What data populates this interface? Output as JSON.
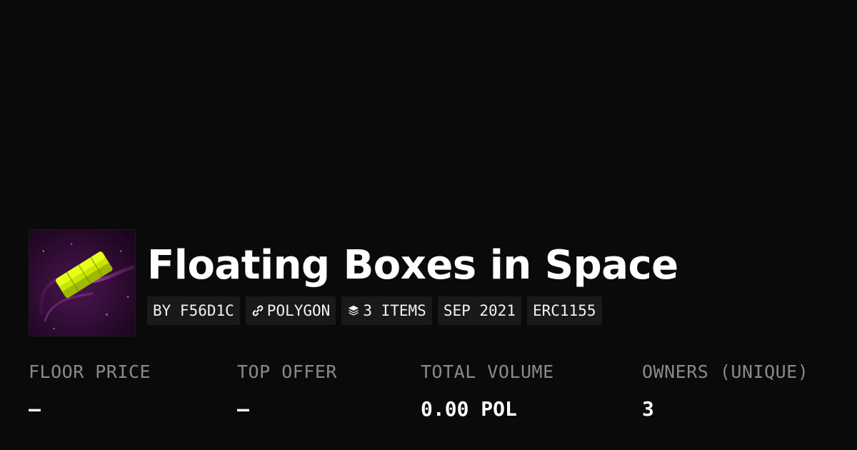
{
  "collection": {
    "title": "Floating Boxes in Space",
    "thumbnail_icon": "floating-box-artwork",
    "tags": {
      "creator": "BY F56D1C",
      "chain": "POLYGON",
      "chain_icon": "link-icon",
      "items": "3 ITEMS",
      "items_icon": "layers-icon",
      "date": "SEP 2021",
      "standard": "ERC1155"
    }
  },
  "stats": {
    "floor_price": {
      "label": "FLOOR PRICE",
      "value": "–"
    },
    "top_offer": {
      "label": "TOP OFFER",
      "value": "–"
    },
    "total_volume": {
      "label": "TOTAL VOLUME",
      "value": "0.00 POL"
    },
    "owners": {
      "label": "OWNERS (UNIQUE)",
      "value": "3"
    }
  },
  "colors": {
    "background": "#0a0a0a",
    "tag_background": "#191919",
    "label_gray": "#8a8a8a",
    "art_purple": "#3a0f3c",
    "art_lime": "#d4f000"
  }
}
